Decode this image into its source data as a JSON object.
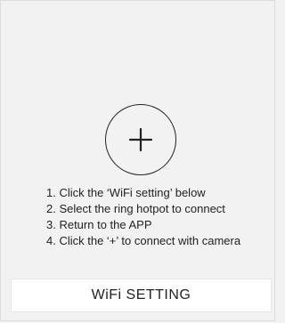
{
  "main": {
    "add_icon": "plus-icon",
    "steps": [
      "1. Click the ‘WiFi setting’ below",
      "2. Select the ring hotpot to connect",
      "3. Return to the APP",
      "4. Click the ‘+’ to connect with camera"
    ]
  },
  "footer": {
    "wifi_button_label": "WiFi SETTING"
  }
}
